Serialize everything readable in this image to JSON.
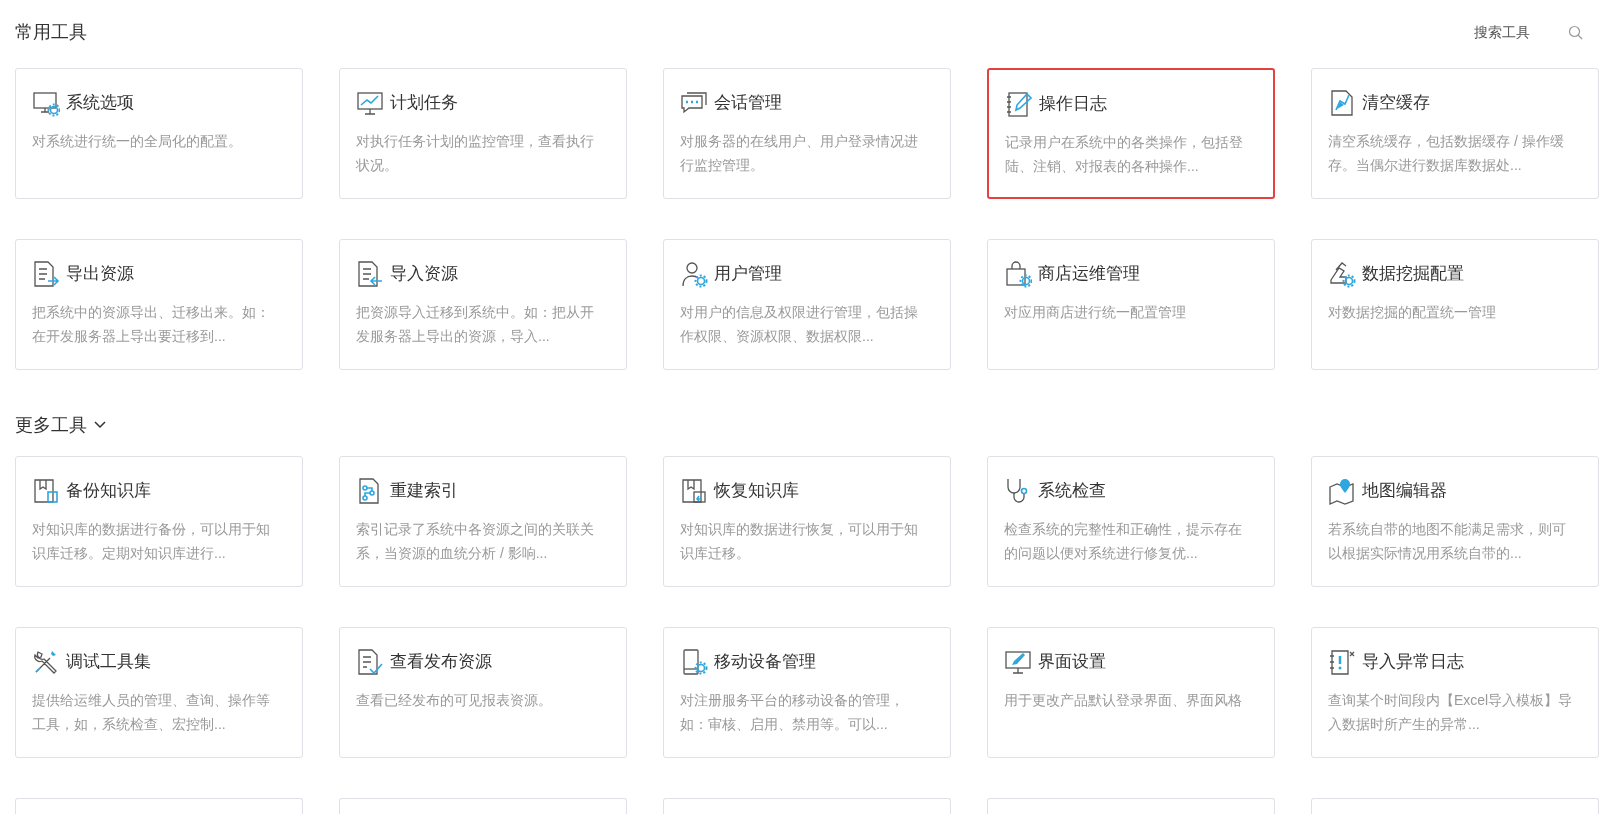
{
  "common_tools": {
    "title": "常用工具",
    "search": {
      "placeholder": "搜索工具"
    },
    "cards": [
      {
        "title": "系统选项",
        "description": "对系统进行统一的全局化的配置。",
        "selected": false
      },
      {
        "title": "计划任务",
        "description": "对执行任务计划的监控管理，查看执行状况。",
        "selected": false
      },
      {
        "title": "会话管理",
        "description": "对服务器的在线用户、用户登录情况进行监控管理。",
        "selected": false
      },
      {
        "title": "操作日志",
        "description": "记录用户在系统中的各类操作，包括登陆、注销、对报表的各种操作...",
        "selected": true
      },
      {
        "title": "清空缓存",
        "description": "清空系统缓存，包括数据缓存 / 操作缓存。当偶尔进行数据库数据处...",
        "selected": false
      },
      {
        "title": "导出资源",
        "description": "把系统中的资源导出、迁移出来。如：在开发服务器上导出要迁移到...",
        "selected": false
      },
      {
        "title": "导入资源",
        "description": "把资源导入迁移到系统中。如：把从开发服务器上导出的资源，导入...",
        "selected": false
      },
      {
        "title": "用户管理",
        "description": "对用户的信息及权限进行管理，包括操作权限、资源权限、数据权限...",
        "selected": false
      },
      {
        "title": "商店运维管理",
        "description": "对应用商店进行统一配置管理",
        "selected": false
      },
      {
        "title": "数据挖掘配置",
        "description": "对数据挖掘的配置统一管理",
        "selected": false
      }
    ]
  },
  "more_tools": {
    "title": "更多工具",
    "expanded": true,
    "cards": [
      {
        "title": "备份知识库",
        "description": "对知识库的数据进行备份，可以用于知识库迁移。定期对知识库进行...",
        "selected": false
      },
      {
        "title": "重建索引",
        "description": "索引记录了系统中各资源之间的关联关系，当资源的血统分析 / 影响...",
        "selected": false
      },
      {
        "title": "恢复知识库",
        "description": "对知识库的数据进行恢复，可以用于知识库迁移。",
        "selected": false
      },
      {
        "title": "系统检查",
        "description": "检查系统的完整性和正确性，提示存在的问题以便对系统进行修复优...",
        "selected": false
      },
      {
        "title": "地图编辑器",
        "description": "若系统自带的地图不能满足需求，则可以根据实际情况用系统自带的...",
        "selected": false
      },
      {
        "title": "调试工具集",
        "description": "提供给运维人员的管理、查询、操作等工具，如，系统检查、宏控制...",
        "selected": false
      },
      {
        "title": "查看发布资源",
        "description": "查看已经发布的可见报表资源。",
        "selected": false
      },
      {
        "title": "移动设备管理",
        "description": "对注册服务平台的移动设备的管理，如：审核、启用、禁用等。可以...",
        "selected": false
      },
      {
        "title": "界面设置",
        "description": "用于更改产品默认登录界面、界面风格",
        "selected": false
      },
      {
        "title": "导入异常日志",
        "description": "查询某个时间段内【Excel导入模板】导入数据时所产生的异常...",
        "selected": false
      }
    ]
  }
}
